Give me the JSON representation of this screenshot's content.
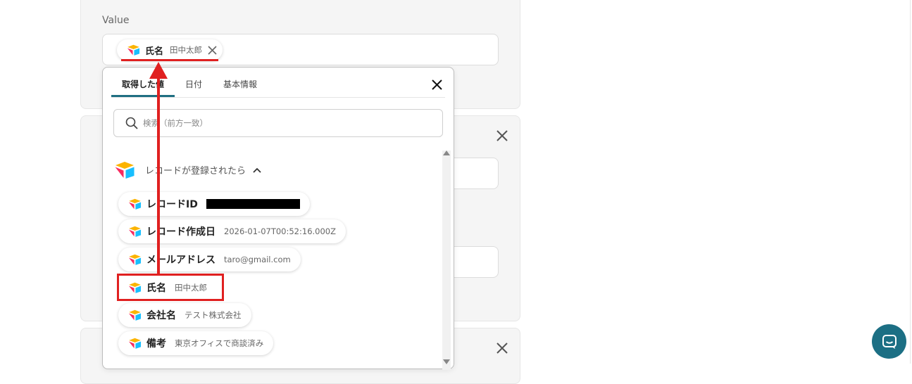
{
  "field": {
    "label": "Value",
    "selected_chip": {
      "key": "氏名",
      "value": "田中太郎"
    }
  },
  "dropdown": {
    "tabs": [
      {
        "label": "取得した値",
        "active": true
      },
      {
        "label": "日付",
        "active": false
      },
      {
        "label": "基本情報",
        "active": false
      }
    ],
    "search_placeholder": "検索（前方一致）",
    "section_title": "レコードが登録されたら",
    "items": [
      {
        "key": "レコードID",
        "value": "",
        "redacted": true
      },
      {
        "key": "レコード作成日",
        "value": "2026-01-07T00:52:16.000Z"
      },
      {
        "key": "メールアドレス",
        "value": "taro@gmail.com"
      },
      {
        "key": "氏名",
        "value": "田中太郎"
      },
      {
        "key": "会社名",
        "value": "テスト株式会社"
      },
      {
        "key": "備考",
        "value": "東京オフィスで商談済み"
      }
    ]
  },
  "annotation_color": "#e02020",
  "accent_color": "#1c6f84",
  "icons": [
    "airtable-logo-icon",
    "close-icon",
    "search-icon",
    "chevron-up-icon",
    "chat-icon"
  ]
}
